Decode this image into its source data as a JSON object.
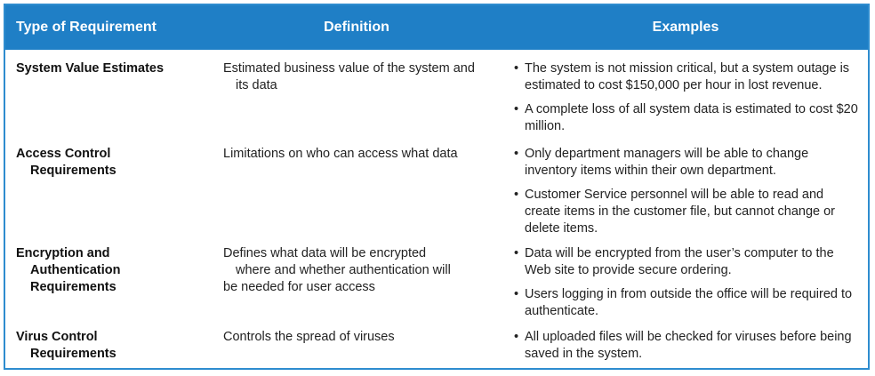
{
  "header": {
    "col1": "Type of Requirement",
    "col2": "Definition",
    "col3": "Examples"
  },
  "rows": [
    {
      "type_lines": [
        "System Value Estimates"
      ],
      "definition_lines": [
        "Estimated business value of the system and",
        "its data"
      ],
      "examples": [
        "The system is not mission critical, but a system outage is estimated to cost $150,000 per hour in lost revenue.",
        "A complete loss of all system data is estimated to cost $20 million."
      ]
    },
    {
      "type_lines": [
        "Access Control",
        "Requirements"
      ],
      "definition_lines": [
        "Limitations on who can access what data"
      ],
      "examples": [
        "Only department managers will be able to change inventory items within their own department.",
        "Customer Service personnel will be able to read and create items in the customer file, but cannot change or delete items."
      ]
    },
    {
      "type_lines": [
        "Encryption and",
        "Authentication",
        "Requirements"
      ],
      "definition_lines": [
        "Defines what data will be encrypted",
        "where and whether authentication will",
        "be needed for user access"
      ],
      "examples": [
        "Data will be encrypted from the user’s computer to the Web site to provide secure ordering.",
        "Users logging in from outside the office will be required to authenticate."
      ]
    },
    {
      "type_lines": [
        "Virus Control",
        "Requirements"
      ],
      "definition_lines": [
        "Controls the spread of viruses"
      ],
      "examples": [
        "All uploaded files will be checked for viruses before being saved in the system."
      ]
    }
  ]
}
